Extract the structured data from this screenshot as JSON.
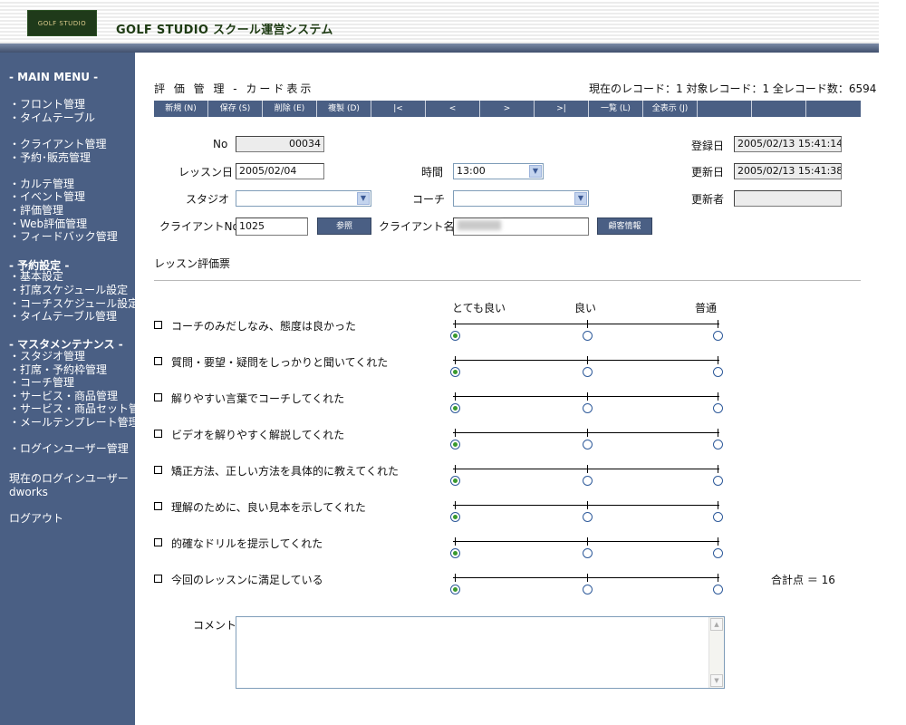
{
  "header": {
    "logo_text": "GOLF STUDIO",
    "app_title": "GOLF STUDIO スクール運営システム"
  },
  "sidebar": {
    "main_menu": "- MAIN MENU -",
    "groups": [
      {
        "items": [
          "・フロント管理",
          "・タイムテーブル"
        ]
      },
      {
        "items": [
          "・クライアント管理",
          "・予約･販売管理"
        ]
      },
      {
        "items": [
          "・カルテ管理",
          "・イベント管理",
          "・評価管理",
          "・Web評価管理",
          "・フィードバック管理"
        ]
      },
      {
        "heading": "- 予約設定 -",
        "items": [
          "・基本設定",
          "・打席スケジュール設定",
          "・コーチスケジュール設定",
          "・タイムテーブル管理"
        ]
      },
      {
        "heading": "- マスタメンテナンス -",
        "items": [
          "・スタジオ管理",
          "・打席・予約枠管理",
          "・コーチ管理",
          "・サービス・商品管理",
          "・サービス・商品セット管理",
          "・メールテンプレート管理"
        ]
      },
      {
        "items": [
          "・ログインユーザー管理"
        ]
      }
    ],
    "login_user_label": "現在のログインユーザー",
    "login_user": "dworks",
    "logout": "ログアウト"
  },
  "main": {
    "title": "評 価 管 理 - カード表示",
    "record_info": "現在のレコード：1  対象レコード：1  全レコード数：6594",
    "toolbar": [
      "新規 (N)",
      "保存 (S)",
      "削除 (E)",
      "複製 (D)",
      "|<",
      "<",
      ">",
      ">|",
      "一覧 (L)",
      "全表示 (J)",
      "",
      "",
      ""
    ],
    "form": {
      "no_label": "No",
      "no_value": "00034",
      "lesson_date_label": "レッスン日",
      "lesson_date": "2005/02/04",
      "time_label": "時間",
      "time_value": "13:00",
      "studio_label": "スタジオ",
      "studio_value": "",
      "coach_label": "コーチ",
      "coach_value": "",
      "client_no_label": "クライアントNo",
      "client_no": "1025",
      "ref_button": "参照",
      "client_name_label": "クライアント名",
      "client_name": "",
      "customer_info_button": "顧客情報",
      "registered_label": "登録日",
      "registered": "2005/02/13 15:41:14",
      "updated_label": "更新日",
      "updated": "2005/02/13 15:41:38",
      "updater_label": "更新者",
      "updater": ""
    },
    "evaluation": {
      "section_title": "レッスン評価票",
      "scale": [
        "とても良い",
        "良い",
        "普通"
      ],
      "questions": [
        {
          "text": "コーチのみだしなみ、態度は良かった",
          "selected": 0
        },
        {
          "text": "質問・要望・疑問をしっかりと聞いてくれた",
          "selected": 0
        },
        {
          "text": "解りやすい言葉でコーチしてくれた",
          "selected": 0
        },
        {
          "text": "ビデオを解りやすく解説してくれた",
          "selected": 0
        },
        {
          "text": "矯正方法、正しい方法を具体的に教えてくれた",
          "selected": 0
        },
        {
          "text": "理解のために、良い見本を示してくれた",
          "selected": 0
        },
        {
          "text": "的確なドリルを提示してくれた",
          "selected": 0
        },
        {
          "text": "今回のレッスンに満足している",
          "selected": 0
        }
      ],
      "total_label": "合計点 ＝ 16",
      "comment_label": "コメント",
      "comment": ""
    }
  }
}
